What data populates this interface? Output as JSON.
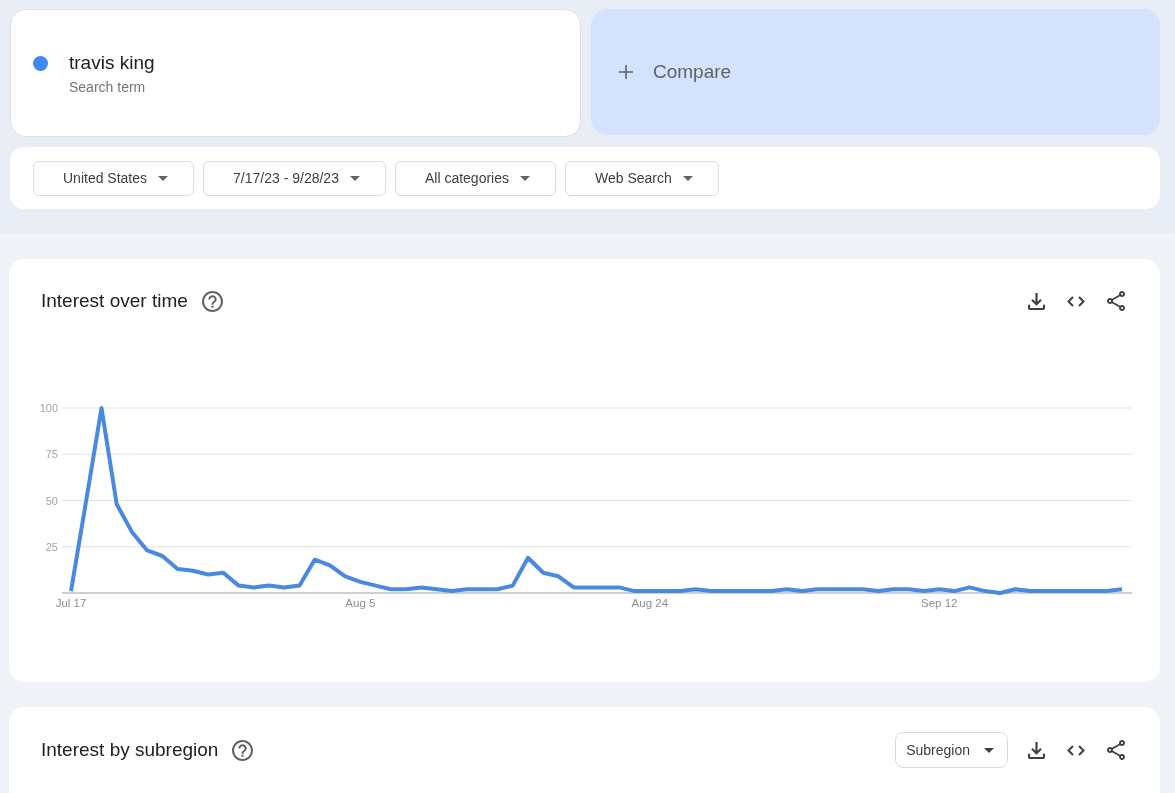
{
  "search_terms": [
    {
      "term": "travis king",
      "label": "Search term",
      "color": "#4285f4"
    }
  ],
  "compare": {
    "label": "Compare"
  },
  "filters": [
    {
      "label": "United States"
    },
    {
      "label": "7/17/23 - 9/28/23"
    },
    {
      "label": "All categories"
    },
    {
      "label": "Web Search"
    }
  ],
  "interest_over_time": {
    "title": "Interest over time",
    "chart_data": {
      "type": "line",
      "categories": [
        "Jul 17",
        null,
        null,
        null,
        null,
        null,
        null,
        null,
        null,
        null,
        null,
        null,
        null,
        null,
        null,
        null,
        null,
        null,
        null,
        "Aug 5",
        null,
        null,
        null,
        null,
        null,
        null,
        null,
        null,
        null,
        null,
        null,
        null,
        null,
        null,
        null,
        null,
        null,
        null,
        "Aug 24",
        null,
        null,
        null,
        null,
        null,
        null,
        null,
        null,
        null,
        null,
        null,
        null,
        null,
        null,
        null,
        null,
        null,
        null,
        "Sep 12",
        null,
        null,
        null,
        null,
        null,
        null,
        null,
        null,
        null,
        null,
        null,
        null
      ],
      "series": [
        {
          "color": "#4a89e0",
          "values": [
            1,
            50,
            100,
            48,
            33,
            23,
            20,
            13,
            12,
            10,
            11,
            4,
            3,
            4,
            3,
            4,
            18,
            15,
            9,
            6,
            4,
            2,
            2,
            3,
            2,
            1,
            2,
            2,
            2,
            4,
            19,
            11,
            9,
            3,
            3,
            3,
            3,
            1,
            1,
            1,
            1,
            2,
            1,
            1,
            1,
            1,
            1,
            2,
            1,
            2,
            2,
            2,
            2,
            1,
            2,
            2,
            1,
            2,
            1,
            3,
            1,
            0,
            2,
            1,
            1,
            1,
            1,
            1,
            1,
            2
          ]
        }
      ],
      "ylim": [
        0,
        100
      ],
      "yticks": [
        25,
        50,
        75,
        100
      ],
      "grid": true
    }
  },
  "interest_by_subregion": {
    "title": "Interest by subregion",
    "dropdown": {
      "value": "Subregion"
    }
  }
}
